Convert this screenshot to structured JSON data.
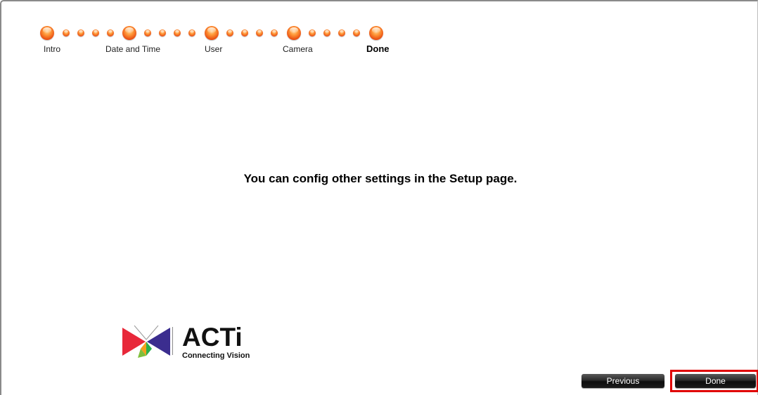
{
  "wizard": {
    "steps": [
      {
        "label": "Intro"
      },
      {
        "label": "Date and Time"
      },
      {
        "label": "User"
      },
      {
        "label": "Camera"
      },
      {
        "label": "Done",
        "current": true
      }
    ]
  },
  "main": {
    "message": "You can config other settings in the Setup page."
  },
  "brand": {
    "name": "ACTi",
    "tagline": "Connecting Vision"
  },
  "buttons": {
    "previous_label": "Previous",
    "done_label": "Done"
  },
  "colors": {
    "step_dot": "#f36b20",
    "highlight": "#e00000"
  }
}
